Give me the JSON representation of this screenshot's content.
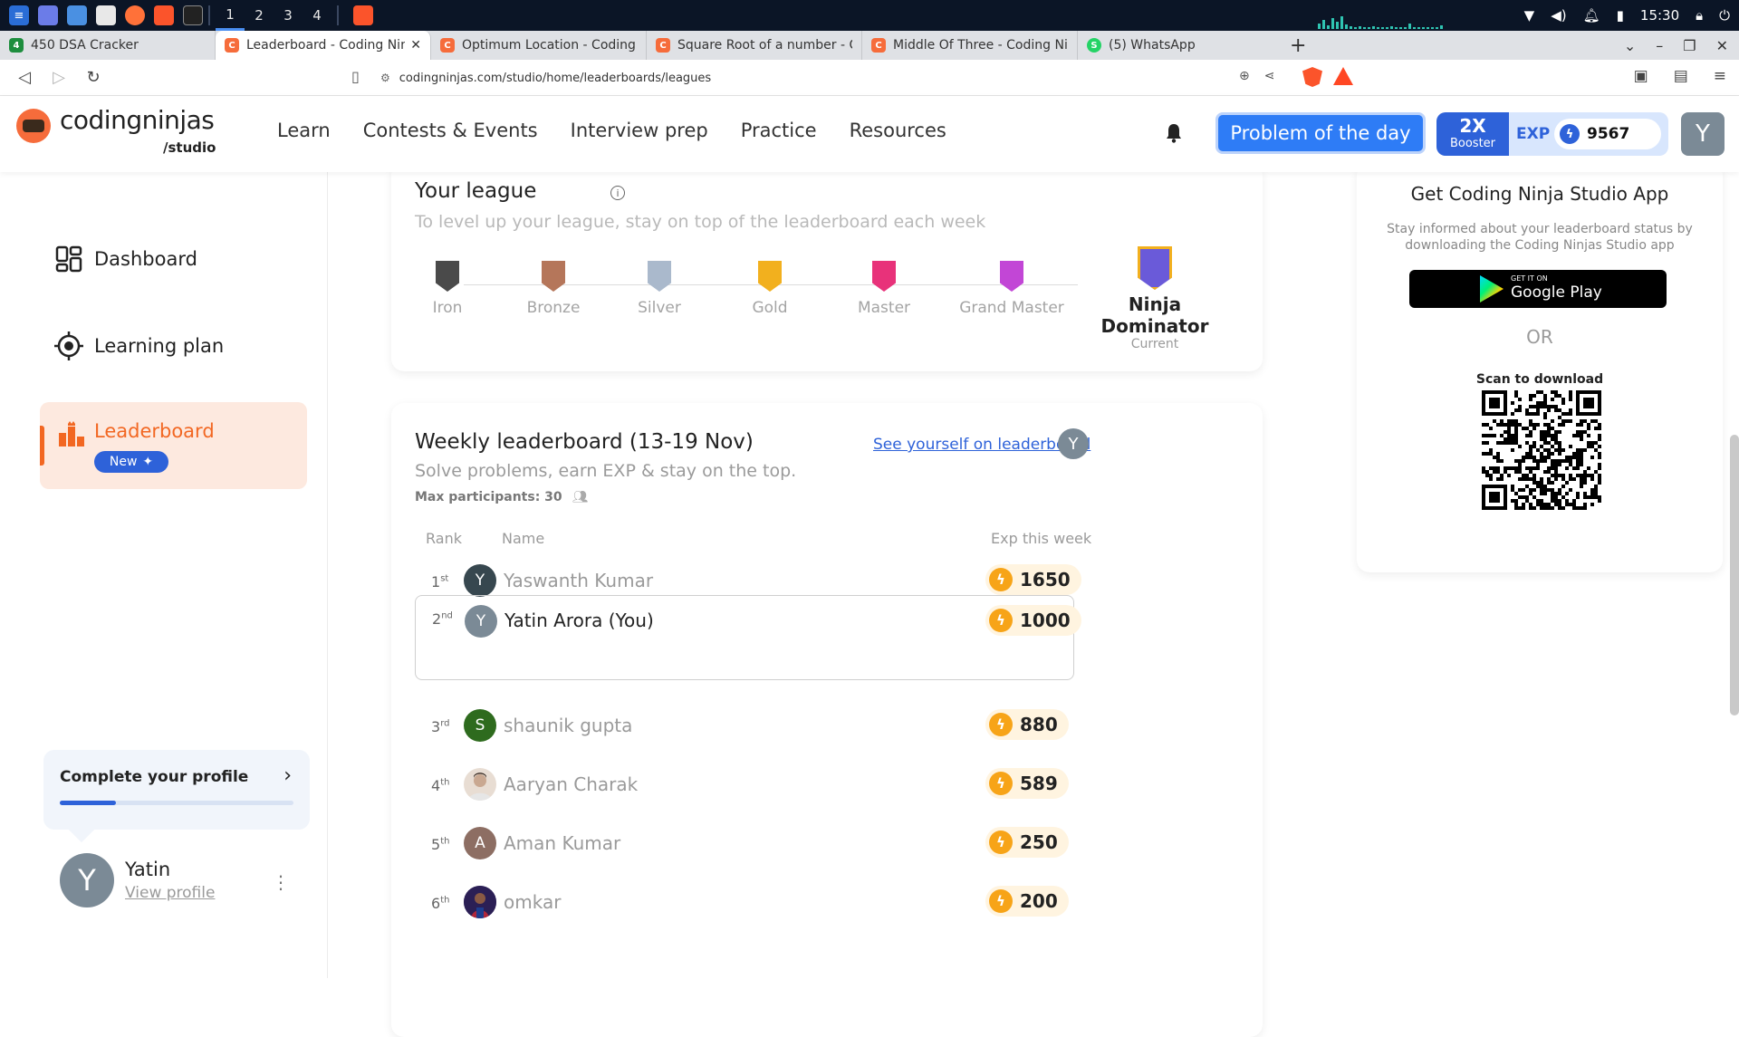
{
  "taskbar": {
    "workspaces": [
      "1",
      "2",
      "3",
      "4"
    ],
    "time": "15:30"
  },
  "browser": {
    "tabs": [
      {
        "title": "450 DSA Cracker",
        "fav_color": "#1e8e3e",
        "fav_char": "4"
      },
      {
        "title": "Leaderboard - Coding Nin",
        "fav_color": "#f66c3b",
        "fav_char": "C",
        "active": true
      },
      {
        "title": "Optimum Location - Coding N",
        "fav_color": "#f66c3b",
        "fav_char": "C"
      },
      {
        "title": "Square Root of a number - Co",
        "fav_color": "#f66c3b",
        "fav_char": "C"
      },
      {
        "title": "Middle Of Three - Coding Ninj",
        "fav_color": "#f66c3b",
        "fav_char": "C"
      },
      {
        "title": "(5) WhatsApp",
        "fav_color": "#25d366",
        "fav_char": "S"
      }
    ],
    "url": "codingninjas.com/studio/home/leaderboards/leagues"
  },
  "header": {
    "logo_text": "codingninjas",
    "logo_sub": "/studio",
    "nav": [
      "Learn",
      "Contests & Events",
      "Interview prep",
      "Practice",
      "Resources"
    ],
    "potd": "Problem of the day",
    "booster_big": "2X",
    "booster_small": "Booster",
    "exp_label": "EXP",
    "exp_value": "9567",
    "avatar_initial": "Y"
  },
  "sidebar": {
    "items": [
      "Dashboard",
      "Learning plan"
    ],
    "active_item": "Leaderboard",
    "new_badge": "New",
    "profile_card_title": "Complete your profile",
    "profile_progress": 0.24,
    "user_initial": "Y",
    "user_name": "Yatin",
    "user_link": "View profile"
  },
  "league": {
    "title": "Your league",
    "subtitle": "To level up your league, stay on top of the leaderboard each week",
    "tiers": [
      {
        "name": "Iron",
        "color": "#4a4a4a"
      },
      {
        "name": "Bronze",
        "color": "#b5765a"
      },
      {
        "name": "Silver",
        "color": "#aab9cc"
      },
      {
        "name": "Gold",
        "color": "#f2b01e"
      },
      {
        "name": "Master",
        "color": "#e8327a"
      },
      {
        "name": "Grand Master",
        "color": "#c246d6"
      },
      {
        "name": "Ninja Dominator",
        "color": "#6a5ad9",
        "current": true
      }
    ],
    "current_label": "Current"
  },
  "leaderboard": {
    "title": "Weekly leaderboard (13-19 Nov)",
    "subtitle": "Solve problems, earn EXP & stay on the top.",
    "max_participants": "Max participants: 30",
    "see_yourself": "See yourself on leaderboard",
    "see_avatar": "Y",
    "columns": {
      "rank": "Rank",
      "name": "Name",
      "exp": "Exp this week"
    },
    "rows": [
      {
        "rank": "1",
        "suffix": "st",
        "initial": "Y",
        "av_color": "#37474f",
        "name": "Yaswanth Kumar",
        "exp": "1650"
      },
      {
        "rank": "2",
        "suffix": "nd",
        "initial": "Y",
        "av_color": "#7b8a96",
        "name": "Yatin Arora (You)",
        "exp": "1000",
        "you": true
      },
      {
        "rank": "3",
        "suffix": "rd",
        "initial": "S",
        "av_color": "#2e6b1e",
        "name": "shaunik gupta",
        "exp": "880"
      },
      {
        "rank": "4",
        "suffix": "th",
        "initial": "",
        "av_color": "#c9a891",
        "name": "Aaryan Charak",
        "exp": "589"
      },
      {
        "rank": "5",
        "suffix": "th",
        "initial": "A",
        "av_color": "#8d6e63",
        "name": "Aman Kumar",
        "exp": "250"
      },
      {
        "rank": "6",
        "suffix": "th",
        "initial": "",
        "av_color": "#3b2a6e",
        "name": "omkar",
        "exp": "200"
      }
    ]
  },
  "app_card": {
    "title": "Get Coding Ninja Studio App",
    "desc": "Stay informed about your leaderboard status by downloading the Coding Ninjas Studio app",
    "gplay_small": "GET IT ON",
    "gplay_big": "Google Play",
    "or": "OR",
    "scan": "Scan to download"
  }
}
